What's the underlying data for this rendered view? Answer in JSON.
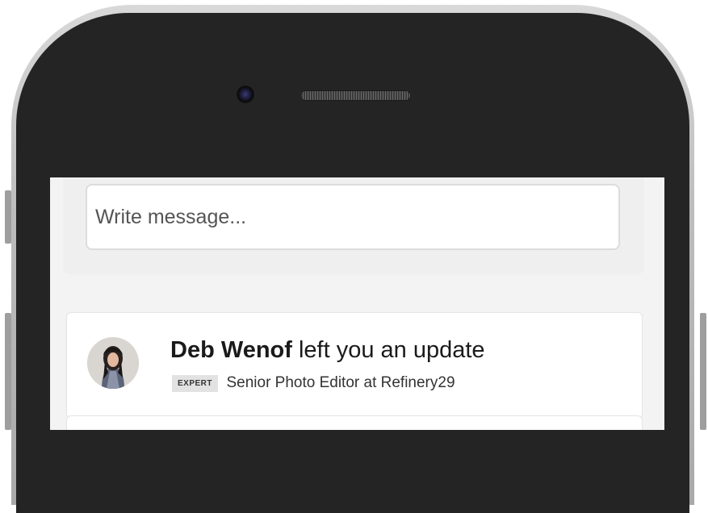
{
  "composer": {
    "placeholder": "Write message..."
  },
  "feed": {
    "item": {
      "author": "Deb Wenof",
      "action": "left you an update",
      "badge": "EXPERT",
      "role": "Senior Photo Editor at Refinery29"
    }
  },
  "colors": {
    "phone_frame": "#242424",
    "screen_bg": "#f3f3f3",
    "badge_bg": "#e2e2e2"
  }
}
